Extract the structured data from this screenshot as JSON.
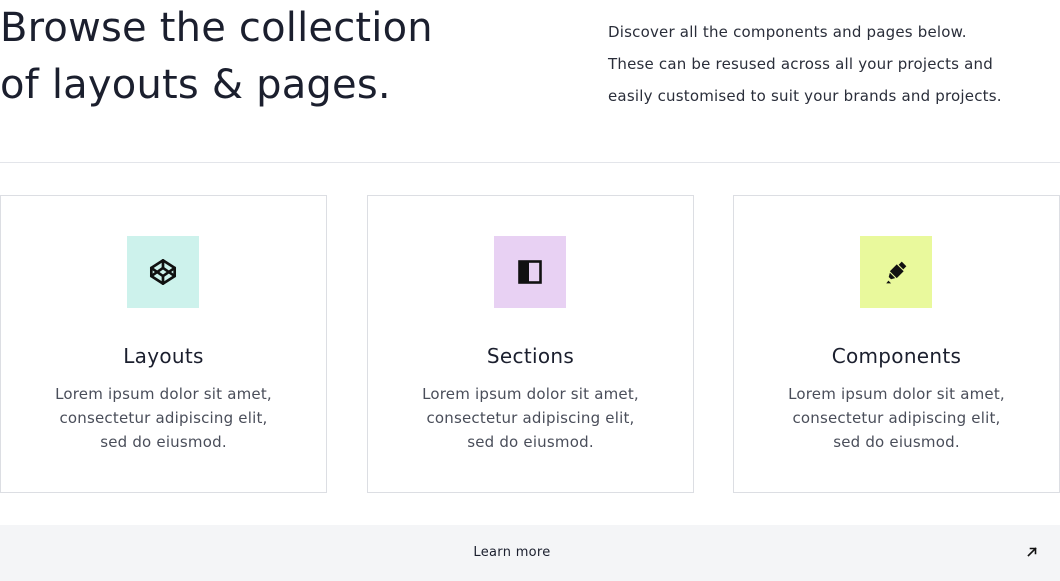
{
  "hero": {
    "title_line1": "Browse the collection",
    "title_line2": "of layouts & pages.",
    "desc_line1": "Discover all the components and pages below.",
    "desc_line2": "These can be resused across all your projects and",
    "desc_line3": "easily customised to suit your brands and projects."
  },
  "cards": [
    {
      "icon": "codepen-icon",
      "icon_bg": "#cdf2ec",
      "title": "Layouts",
      "text_line1": "Lorem ipsum dolor sit amet,",
      "text_line2": "consectetur adipiscing elit,",
      "text_line3": "sed do eiusmod."
    },
    {
      "icon": "sidebar-layout-icon",
      "icon_bg": "#e8d1f3",
      "title": "Sections",
      "text_line1": "Lorem ipsum dolor sit amet,",
      "text_line2": "consectetur adipiscing elit,",
      "text_line3": "sed do eiusmod."
    },
    {
      "icon": "marker-icon",
      "icon_bg": "#e9f99c",
      "title": "Components",
      "text_line1": "Lorem ipsum dolor sit amet,",
      "text_line2": "consectetur adipiscing elit,",
      "text_line3": "sed do eiusmod."
    }
  ],
  "footer": {
    "label": "Learn more",
    "icon": "arrow-up-right-icon"
  }
}
